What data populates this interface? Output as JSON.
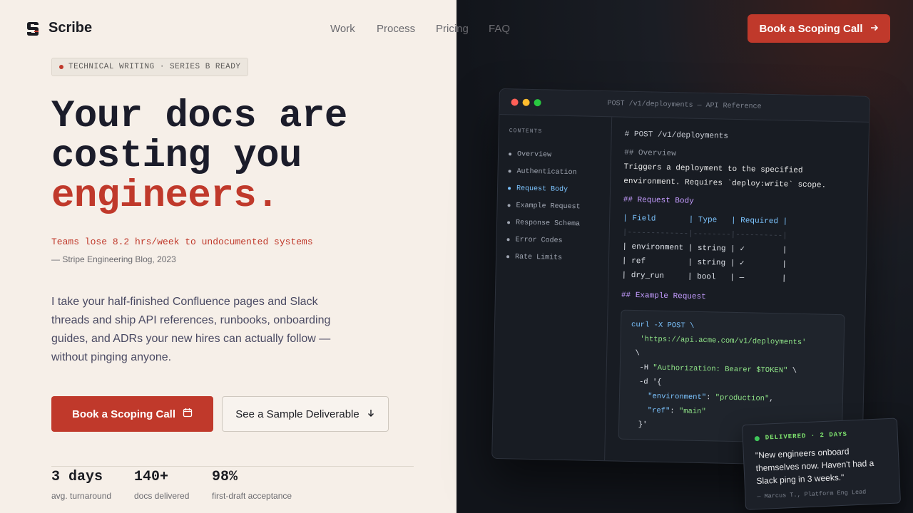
{
  "brand": {
    "name": "Scribe"
  },
  "nav": {
    "links": [
      "Work",
      "Process",
      "Pricing",
      "FAQ"
    ],
    "cta_label": "Book a Scoping Call",
    "cta_icon": "arrow-right-icon"
  },
  "hero": {
    "badge": "TECHNICAL WRITING · SERIES B READY",
    "headline_line1": "Your docs are",
    "headline_line2": "costing you",
    "headline_accent": "engineers.",
    "stat_quote": "Teams lose 8.2 hrs/week to undocumented systems",
    "stat_source": "— Stripe Engineering Blog, 2023",
    "body": "I take your half-finished Confluence pages and Slack threads and ship API references, runbooks, onboarding guides, and ADRs your new hires can actually follow — without pinging anyone.",
    "primary_cta": "Book a Scoping Call",
    "secondary_cta": "See a Sample Deliverable"
  },
  "stats": [
    {
      "value": "3 days",
      "label": "avg. turnaround"
    },
    {
      "value": "140+",
      "label": "docs delivered"
    },
    {
      "value": "98%",
      "label": "first-draft acceptance"
    }
  ],
  "window": {
    "title": "POST /v1/deployments — API Reference",
    "contents_heading": "CONTENTS",
    "toc": [
      "Overview",
      "Authentication",
      "Request Body",
      "Example Request",
      "Response Schema",
      "Error Codes",
      "Rate Limits"
    ],
    "active_toc": "Request Body",
    "h1": "# POST /v1/deployments",
    "overview_h": "## Overview",
    "overview_l1": "Triggers a deployment to the specified",
    "overview_l2": "environment. Requires `deploy:write` scope.",
    "request_h": "## Request Body",
    "table_head": "| Field       | Type   | Required |",
    "table_sep": "|-------------|--------|----------|",
    "table_rows": [
      "| environment | string | ✓        |",
      "| ref         | string | ✓        |",
      "| dry_run     | bool   | —        |"
    ],
    "example_h": "## Example Request",
    "code": {
      "l1_cmd": "curl -X POST \\",
      "l2_url": "'https://api.acme.com/v1/deployments'",
      "l3": "\\",
      "l4_flag": "-H ",
      "l4_str": "\"Authorization: Bearer $TOKEN\"",
      "l4_end": " \\",
      "l5": "-d '{",
      "l6_key": "\"environment\"",
      "l6_val": "\"production\"",
      "l7_key": "\"ref\"",
      "l7_val": "\"main\"",
      "l8": "}'"
    }
  },
  "testimonial": {
    "status": "DELIVERED · 2 DAYS",
    "quote": "\"New engineers onboard themselves now. Haven't had a Slack ping in 3 weeks.\"",
    "author": "— Marcus T., Platform Eng Lead"
  },
  "colors": {
    "accent": "#c0392b",
    "dark": "#12151b",
    "cream": "#f6efe8"
  }
}
